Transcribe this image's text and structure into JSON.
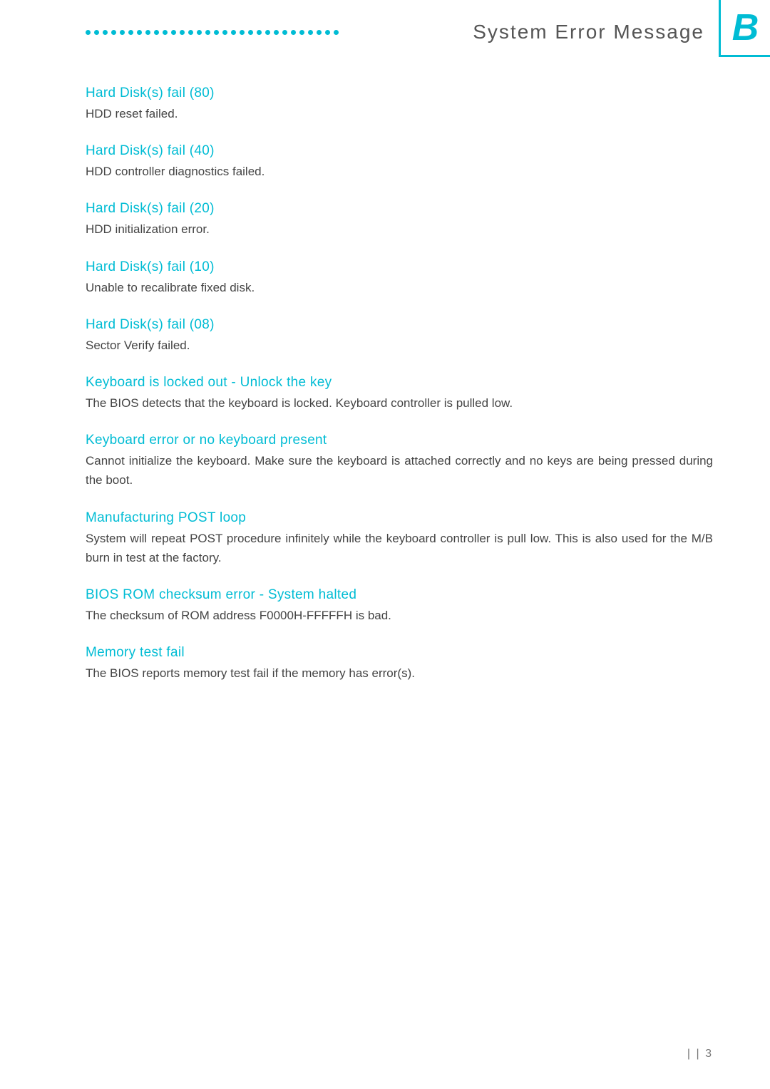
{
  "header": {
    "title": "System Error Message",
    "appendix_letter": "B",
    "dots_count": 30
  },
  "errors": [
    {
      "id": "hdd-fail-80",
      "title": "Hard Disk(s) fail (80)",
      "description": "HDD reset failed."
    },
    {
      "id": "hdd-fail-40",
      "title": "Hard Disk(s) fail (40)",
      "description": "HDD controller diagnostics failed."
    },
    {
      "id": "hdd-fail-20",
      "title": "Hard Disk(s) fail (20)",
      "description": "HDD initialization error."
    },
    {
      "id": "hdd-fail-10",
      "title": "Hard Disk(s) fail (10)",
      "description": "Unable to recalibrate fixed disk."
    },
    {
      "id": "hdd-fail-08",
      "title": "Hard Disk(s) fail (08)",
      "description": "Sector Verify failed."
    },
    {
      "id": "keyboard-locked",
      "title": "Keyboard is locked out - Unlock the key",
      "description": "The BIOS detects that the keyboard is locked. Keyboard controller is pulled low."
    },
    {
      "id": "keyboard-error",
      "title": "Keyboard error or no keyboard present",
      "description": "Cannot initialize the keyboard. Make sure the keyboard is attached correctly and no keys are being pressed during the boot."
    },
    {
      "id": "manufacturing-post",
      "title": "Manufacturing POST loop",
      "description": "System will repeat POST procedure infinitely while the keyboard controller is pull low. This is also used for the M/B burn in test at the factory."
    },
    {
      "id": "bios-rom-checksum",
      "title": "BIOS ROM checksum error - System halted",
      "description": "The checksum of ROM address F0000H-FFFFFH is bad."
    },
    {
      "id": "memory-test-fail",
      "title": "Memory test fail",
      "description": "The BIOS reports memory test fail if the memory has error(s)."
    }
  ],
  "page_number": "| | 3"
}
